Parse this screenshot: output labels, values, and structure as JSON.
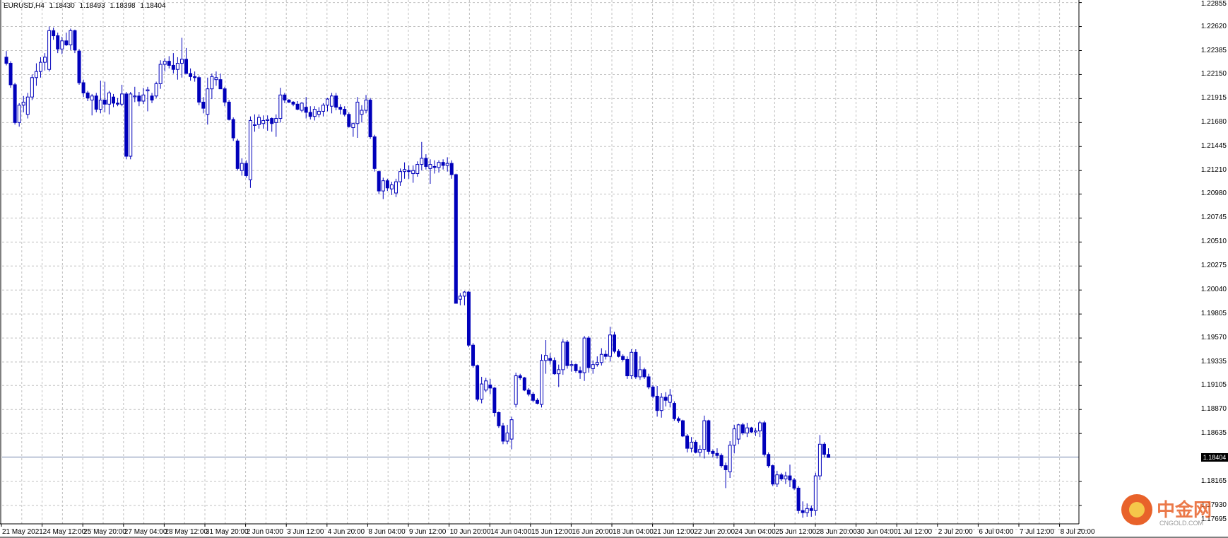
{
  "header": {
    "symbol": "EURUSD,H4",
    "open": "1.18430",
    "high": "1.18493",
    "low": "1.18398",
    "close": "1.18404"
  },
  "current_price_tag": "1.18404",
  "colors": {
    "background": "#ffffff",
    "grid": "#c0c0c0",
    "candle": "#0000bb",
    "axis": "#000000",
    "current_line": "#6c7fa8",
    "watermark": "#e8622a"
  },
  "watermark": {
    "text": "中金网",
    "sub": "CNGOLD.COM"
  },
  "chart_data": {
    "type": "candlestick",
    "symbol": "EURUSD",
    "timeframe": "H4",
    "ylim": [
      1.1775,
      1.2288
    ],
    "grid": true,
    "price_ticks": [
      "1.22855",
      "1.22620",
      "1.22385",
      "1.22150",
      "1.21915",
      "1.21680",
      "1.21445",
      "1.21210",
      "1.20980",
      "1.20745",
      "1.20510",
      "1.20275",
      "1.20040",
      "1.19805",
      "1.19570",
      "1.19335",
      "1.19105",
      "1.18870",
      "1.18635",
      "1.18404",
      "1.18165",
      "1.17930",
      "1.17695"
    ],
    "time_labels": [
      "21 May 2021",
      "24 May 12:00",
      "25 May 20:00",
      "27 May 04:00",
      "28 May 12:00",
      "31 May 20:00",
      "2 Jun 04:00",
      "3 Jun 12:00",
      "4 Jun 20:00",
      "8 Jun 04:00",
      "9 Jun 12:00",
      "10 Jun 20:00",
      "14 Jun 04:00",
      "15 Jun 12:00",
      "16 Jun 20:00",
      "18 Jun 04:00",
      "21 Jun 12:00",
      "22 Jun 20:00",
      "24 Jun 04:00",
      "25 Jun 12:00",
      "28 Jun 20:00",
      "30 Jun 04:00",
      "1 Jul 12:00",
      "2 Jul 20:00",
      "6 Jul 04:00",
      "7 Jul 12:00",
      "8 Jul 20:00"
    ],
    "current_price": 1.18404,
    "candles": [
      [
        1.2232,
        1.2238,
        1.2224,
        1.2226
      ],
      [
        1.2226,
        1.2228,
        1.2202,
        1.2205
      ],
      [
        1.2205,
        1.2207,
        1.2166,
        1.2168
      ],
      [
        1.2168,
        1.2187,
        1.2164,
        1.2185
      ],
      [
        1.2185,
        1.2194,
        1.2178,
        1.2188
      ],
      [
        1.2176,
        1.2197,
        1.2172,
        1.2193
      ],
      [
        1.2193,
        1.2215,
        1.219,
        1.2212
      ],
      [
        1.2212,
        1.2226,
        1.2204,
        1.2218
      ],
      [
        1.2218,
        1.2232,
        1.2212,
        1.2227
      ],
      [
        1.2227,
        1.2236,
        1.2219,
        1.2232
      ],
      [
        1.222,
        1.2262,
        1.2218,
        1.2258
      ],
      [
        1.2258,
        1.2261,
        1.2249,
        1.2253
      ],
      [
        1.2253,
        1.2256,
        1.2236,
        1.224
      ],
      [
        1.224,
        1.2252,
        1.2235,
        1.2248
      ],
      [
        1.2248,
        1.2256,
        1.2243,
        1.2244
      ],
      [
        1.2244,
        1.226,
        1.2239,
        1.2258
      ],
      [
        1.2258,
        1.2259,
        1.2236,
        1.2239
      ],
      [
        1.2238,
        1.224,
        1.2205,
        1.2207
      ],
      [
        1.2207,
        1.221,
        1.2193,
        1.2197
      ],
      [
        1.2197,
        1.2199,
        1.2189,
        1.2192
      ],
      [
        1.219,
        1.2196,
        1.2175,
        1.2194
      ],
      [
        1.2194,
        1.2197,
        1.2178,
        1.2181
      ],
      [
        1.2181,
        1.2209,
        1.2177,
        1.219
      ],
      [
        1.219,
        1.2208,
        1.2178,
        1.2186
      ],
      [
        1.2186,
        1.2199,
        1.2176,
        1.2197
      ],
      [
        1.2193,
        1.2196,
        1.2183,
        1.2187
      ],
      [
        1.2187,
        1.2192,
        1.2184,
        1.2186
      ],
      [
        1.2186,
        1.2205,
        1.2184,
        1.2196
      ],
      [
        1.2196,
        1.2198,
        1.2132,
        1.2135
      ],
      [
        1.2135,
        1.2198,
        1.2132,
        1.2196
      ],
      [
        1.2194,
        1.2203,
        1.2188,
        1.2194
      ],
      [
        1.2194,
        1.2198,
        1.2184,
        1.2189
      ],
      [
        1.2189,
        1.2202,
        1.2186,
        1.2195
      ],
      [
        1.2199,
        1.2203,
        1.2179,
        1.22
      ],
      [
        1.2194,
        1.2197,
        1.2187,
        1.219
      ],
      [
        1.2194,
        1.2208,
        1.2192,
        1.2206
      ],
      [
        1.2206,
        1.2229,
        1.2201,
        1.2225
      ],
      [
        1.2225,
        1.2231,
        1.2218,
        1.2228
      ],
      [
        1.2228,
        1.2233,
        1.2221,
        1.2224
      ],
      [
        1.2224,
        1.2236,
        1.2216,
        1.222
      ],
      [
        1.222,
        1.2232,
        1.221,
        1.2226
      ],
      [
        1.2226,
        1.2251,
        1.2212,
        1.223
      ],
      [
        1.223,
        1.2241,
        1.2219,
        1.2216
      ],
      [
        1.2216,
        1.2221,
        1.2209,
        1.2213
      ],
      [
        1.2213,
        1.2218,
        1.2208,
        1.2212
      ],
      [
        1.2212,
        1.2214,
        1.2185,
        1.2188
      ],
      [
        1.2188,
        1.2193,
        1.2177,
        1.2182
      ],
      [
        1.2176,
        1.2212,
        1.2166,
        1.2201
      ],
      [
        1.2201,
        1.2216,
        1.2191,
        1.2213
      ],
      [
        1.221,
        1.2218,
        1.2204,
        1.2212
      ],
      [
        1.221,
        1.2216,
        1.2204,
        1.2201
      ],
      [
        1.2201,
        1.2203,
        1.2184,
        1.2188
      ],
      [
        1.2188,
        1.219,
        1.217,
        1.2171
      ],
      [
        1.2171,
        1.2173,
        1.215,
        1.2153
      ],
      [
        1.215,
        1.2152,
        1.2121,
        1.2123
      ],
      [
        1.2121,
        1.2133,
        1.2116,
        1.2128
      ],
      [
        1.2128,
        1.2131,
        1.2114,
        1.2116
      ],
      [
        1.2112,
        1.2174,
        1.2104,
        1.217
      ],
      [
        1.2166,
        1.2176,
        1.2159,
        1.2166
      ],
      [
        1.2166,
        1.2176,
        1.2162,
        1.2173
      ],
      [
        1.2167,
        1.2175,
        1.2162,
        1.217
      ],
      [
        1.217,
        1.2175,
        1.216,
        1.2171
      ],
      [
        1.2172,
        1.2173,
        1.2159,
        1.2167
      ],
      [
        1.2168,
        1.2176,
        1.2154,
        1.2172
      ],
      [
        1.2172,
        1.2202,
        1.2168,
        1.2195
      ],
      [
        1.2195,
        1.2197,
        1.2187,
        1.219
      ],
      [
        1.219,
        1.2191,
        1.2187,
        1.2188
      ],
      [
        1.2188,
        1.2189,
        1.2184,
        1.2186
      ],
      [
        1.2186,
        1.2189,
        1.218,
        1.2181
      ],
      [
        1.218,
        1.2188,
        1.2178,
        1.2187
      ],
      [
        1.2183,
        1.2193,
        1.2172,
        1.2178
      ],
      [
        1.2178,
        1.2184,
        1.2171,
        1.2174
      ],
      [
        1.2174,
        1.2184,
        1.217,
        1.2181
      ],
      [
        1.2176,
        1.2183,
        1.2173,
        1.2179
      ],
      [
        1.2179,
        1.2187,
        1.2174,
        1.2185
      ],
      [
        1.2185,
        1.2192,
        1.2179,
        1.2191
      ],
      [
        1.2184,
        1.2197,
        1.2177,
        1.2194
      ],
      [
        1.2194,
        1.2197,
        1.218,
        1.2183
      ],
      [
        1.2183,
        1.2186,
        1.2176,
        1.2181
      ],
      [
        1.2181,
        1.2184,
        1.2174,
        1.2176
      ],
      [
        1.2176,
        1.2178,
        1.2163,
        1.2164
      ],
      [
        1.2163,
        1.2168,
        1.2154,
        1.2167
      ],
      [
        1.2167,
        1.2193,
        1.2153,
        1.2188
      ],
      [
        1.2176,
        1.2185,
        1.2168,
        1.218
      ],
      [
        1.218,
        1.2195,
        1.2177,
        1.219
      ],
      [
        1.219,
        1.2192,
        1.2152,
        1.2154
      ],
      [
        1.2154,
        1.2156,
        1.212,
        1.2123
      ],
      [
        1.212,
        1.2121,
        1.2098,
        1.2101
      ],
      [
        1.2101,
        1.2114,
        1.2093,
        1.2111
      ],
      [
        1.2111,
        1.2113,
        1.2101,
        1.2104
      ],
      [
        1.2103,
        1.211,
        1.2097,
        1.2107
      ],
      [
        1.2099,
        1.2113,
        1.2095,
        1.211
      ],
      [
        1.211,
        1.2123,
        1.2106,
        1.212
      ],
      [
        1.212,
        1.2129,
        1.2113,
        1.2122
      ],
      [
        1.2121,
        1.2126,
        1.2113,
        1.212
      ],
      [
        1.2118,
        1.2126,
        1.2109,
        1.2121
      ],
      [
        1.2118,
        1.213,
        1.2115,
        1.2127
      ],
      [
        1.2127,
        1.2149,
        1.2121,
        1.2133
      ],
      [
        1.2133,
        1.2137,
        1.2122,
        1.2125
      ],
      [
        1.2123,
        1.2132,
        1.2108,
        1.2127
      ],
      [
        1.2125,
        1.2131,
        1.2118,
        1.2124
      ],
      [
        1.2124,
        1.2131,
        1.2119,
        1.2129
      ],
      [
        1.2129,
        1.2132,
        1.2122,
        1.2126
      ],
      [
        1.2126,
        1.2134,
        1.212,
        1.2128
      ],
      [
        1.2128,
        1.2131,
        1.2113,
        1.2117
      ],
      [
        1.2117,
        1.2118,
        1.2062,
        1.1991
      ],
      [
        1.1995,
        1.2001,
        1.1989,
        1.1998
      ],
      [
        1.1998,
        1.2003,
        1.1989,
        1.2002
      ],
      [
        1.2002,
        1.2003,
        1.1948,
        1.195
      ],
      [
        1.195,
        1.1952,
        1.1928,
        1.193
      ],
      [
        1.193,
        1.1931,
        1.1895,
        1.1897
      ],
      [
        1.1897,
        1.1919,
        1.1893,
        1.1912
      ],
      [
        1.1906,
        1.1918,
        1.1904,
        1.1915
      ],
      [
        1.1911,
        1.1917,
        1.1902,
        1.1908
      ],
      [
        1.1908,
        1.1909,
        1.188,
        1.1884
      ],
      [
        1.1884,
        1.1885,
        1.1869,
        1.1871
      ],
      [
        1.1871,
        1.1874,
        1.1853,
        1.1856
      ],
      [
        1.1856,
        1.1872,
        1.1853,
        1.1864
      ],
      [
        1.1858,
        1.188,
        1.1848,
        1.1877
      ],
      [
        1.1892,
        1.1923,
        1.1889,
        1.192
      ],
      [
        1.192,
        1.1922,
        1.1916,
        1.1918
      ],
      [
        1.1918,
        1.1919,
        1.1905,
        1.1906
      ],
      [
        1.1906,
        1.1908,
        1.19,
        1.1902
      ],
      [
        1.1902,
        1.1904,
        1.1894,
        1.1896
      ],
      [
        1.1896,
        1.1898,
        1.1892,
        1.1893
      ],
      [
        1.1892,
        1.1941,
        1.1889,
        1.1935
      ],
      [
        1.1935,
        1.1955,
        1.1922,
        1.194
      ],
      [
        1.1937,
        1.1942,
        1.1931,
        1.1935
      ],
      [
        1.1935,
        1.1938,
        1.1921,
        1.1922
      ],
      [
        1.1922,
        1.1931,
        1.1909,
        1.1926
      ],
      [
        1.1926,
        1.1956,
        1.1921,
        1.1953
      ],
      [
        1.1953,
        1.1955,
        1.1927,
        1.193
      ],
      [
        1.193,
        1.1935,
        1.1924,
        1.1931
      ],
      [
        1.1931,
        1.1932,
        1.1923,
        1.1925
      ],
      [
        1.1925,
        1.1929,
        1.1917,
        1.1923
      ],
      [
        1.1923,
        1.1959,
        1.1915,
        1.1957
      ],
      [
        1.1957,
        1.1959,
        1.1923,
        1.1928
      ],
      [
        1.1927,
        1.1935,
        1.1922,
        1.1931
      ],
      [
        1.1931,
        1.1939,
        1.1929,
        1.1933
      ],
      [
        1.1933,
        1.1947,
        1.193,
        1.1941
      ],
      [
        1.1941,
        1.1945,
        1.1936,
        1.1939
      ],
      [
        1.1939,
        1.1968,
        1.1934,
        1.196
      ],
      [
        1.196,
        1.1963,
        1.1942,
        1.1944
      ],
      [
        1.1944,
        1.1946,
        1.1938,
        1.1939
      ],
      [
        1.1939,
        1.1941,
        1.1934,
        1.1936
      ],
      [
        1.1936,
        1.1939,
        1.1917,
        1.192
      ],
      [
        1.192,
        1.1946,
        1.1917,
        1.1943
      ],
      [
        1.1943,
        1.1946,
        1.1917,
        1.1919
      ],
      [
        1.1919,
        1.1939,
        1.1916,
        1.1926
      ],
      [
        1.1926,
        1.1928,
        1.1917,
        1.1919
      ],
      [
        1.1919,
        1.1922,
        1.1907,
        1.1909
      ],
      [
        1.1909,
        1.1911,
        1.1898,
        1.19
      ],
      [
        1.19,
        1.191,
        1.188,
        1.1886
      ],
      [
        1.1886,
        1.1903,
        1.1879,
        1.1899
      ],
      [
        1.1899,
        1.1904,
        1.189,
        1.1896
      ],
      [
        1.1894,
        1.1907,
        1.1889,
        1.1901
      ],
      [
        1.1893,
        1.1895,
        1.1876,
        1.1878
      ],
      [
        1.1878,
        1.188,
        1.1874,
        1.1876
      ],
      [
        1.1876,
        1.1877,
        1.186,
        1.1861
      ],
      [
        1.1861,
        1.1863,
        1.1845,
        1.1849
      ],
      [
        1.1849,
        1.186,
        1.1845,
        1.1855
      ],
      [
        1.1855,
        1.1857,
        1.1844,
        1.1845
      ],
      [
        1.1845,
        1.1852,
        1.1841,
        1.1848
      ],
      [
        1.1848,
        1.1881,
        1.1839,
        1.1876
      ],
      [
        1.1876,
        1.1877,
        1.1843,
        1.1846
      ],
      [
        1.1846,
        1.1848,
        1.184,
        1.1844
      ],
      [
        1.1844,
        1.1849,
        1.1839,
        1.1842
      ],
      [
        1.1842,
        1.1844,
        1.183,
        1.1832
      ],
      [
        1.1832,
        1.1835,
        1.181,
        1.1828
      ],
      [
        1.1826,
        1.1856,
        1.182,
        1.1852
      ],
      [
        1.1852,
        1.1872,
        1.1844,
        1.1868
      ],
      [
        1.1858,
        1.1873,
        1.1853,
        1.1872
      ],
      [
        1.1872,
        1.1874,
        1.1862,
        1.1864
      ],
      [
        1.1864,
        1.1874,
        1.186,
        1.1869
      ],
      [
        1.1869,
        1.187,
        1.1864,
        1.1865
      ],
      [
        1.1865,
        1.1869,
        1.1861,
        1.1866
      ],
      [
        1.1866,
        1.1876,
        1.186,
        1.1874
      ],
      [
        1.1874,
        1.1876,
        1.1841,
        1.1843
      ],
      [
        1.1843,
        1.1845,
        1.183,
        1.1832
      ],
      [
        1.1832,
        1.1833,
        1.1812,
        1.1814
      ],
      [
        1.1814,
        1.1827,
        1.1811,
        1.1823
      ],
      [
        1.1823,
        1.1825,
        1.1817,
        1.1819
      ],
      [
        1.1819,
        1.1826,
        1.1814,
        1.1822
      ],
      [
        1.1822,
        1.1833,
        1.1811,
        1.1818
      ],
      [
        1.1818,
        1.182,
        1.1808,
        1.181
      ],
      [
        1.181,
        1.1812,
        1.1785,
        1.1788
      ],
      [
        1.1788,
        1.1797,
        1.1781,
        1.1786
      ],
      [
        1.1786,
        1.1795,
        1.1782,
        1.179
      ],
      [
        1.179,
        1.1793,
        1.1782,
        1.1788
      ],
      [
        1.1788,
        1.1825,
        1.1783,
        1.1822
      ],
      [
        1.1822,
        1.1862,
        1.1818,
        1.1853
      ],
      [
        1.1853,
        1.1855,
        1.184,
        1.1843
      ],
      [
        1.1843,
        1.1849,
        1.184,
        1.184
      ]
    ]
  }
}
